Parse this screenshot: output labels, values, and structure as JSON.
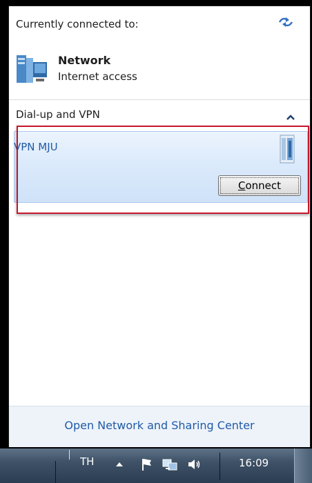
{
  "flyout": {
    "header": "Currently connected to:",
    "network": {
      "name": "Network",
      "status": "Internet access"
    },
    "section_title": "Dial-up and VPN",
    "vpn": {
      "name": "VPN MJU",
      "connect_label": "onnect",
      "connect_accel": "C"
    },
    "footer_link": "Open Network and Sharing Center"
  },
  "taskbar": {
    "language": "TH",
    "clock": "16:09"
  },
  "colors": {
    "link_blue": "#1f5aa6",
    "highlight_red": "#c6162b",
    "taskbar_blue": "#3e5166"
  }
}
